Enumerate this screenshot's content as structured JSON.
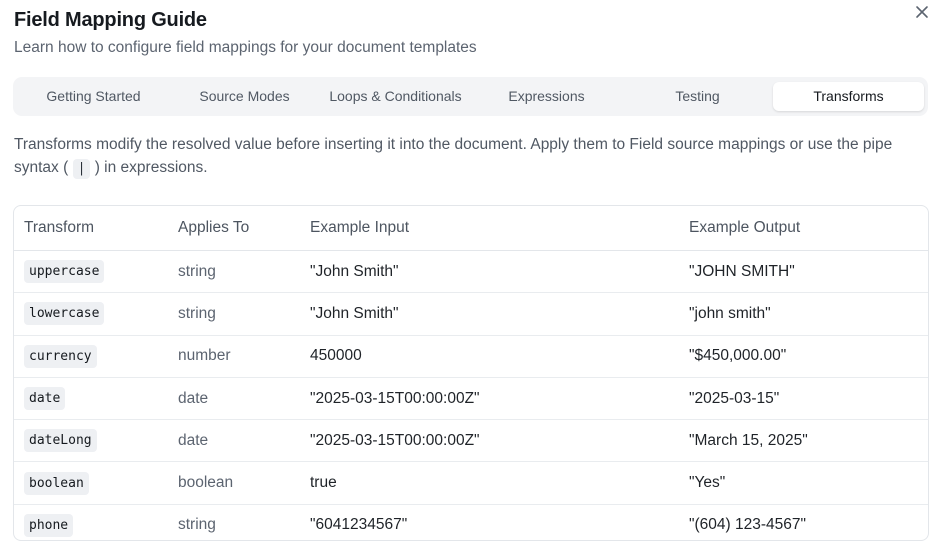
{
  "header": {
    "title": "Field Mapping Guide",
    "subtitle": "Learn how to configure field mappings for your document templates"
  },
  "tabs": [
    {
      "label": "Getting Started",
      "active": false
    },
    {
      "label": "Source Modes",
      "active": false
    },
    {
      "label": "Loops & Conditionals",
      "active": false
    },
    {
      "label": "Expressions",
      "active": false
    },
    {
      "label": "Testing",
      "active": false
    },
    {
      "label": "Transforms",
      "active": true
    }
  ],
  "description": {
    "before": "Transforms modify the resolved value before inserting it into the document. Apply them to Field source mappings or use the pipe syntax (",
    "pipe": "|",
    "after": ") in expressions."
  },
  "table": {
    "headers": [
      "Transform",
      "Applies To",
      "Example Input",
      "Example Output"
    ],
    "rows": [
      {
        "transform": "uppercase",
        "applies": "string",
        "input": "\"John Smith\"",
        "output": "\"JOHN SMITH\""
      },
      {
        "transform": "lowercase",
        "applies": "string",
        "input": "\"John Smith\"",
        "output": "\"john smith\""
      },
      {
        "transform": "currency",
        "applies": "number",
        "input": "450000",
        "output": "\"$450,000.00\""
      },
      {
        "transform": "date",
        "applies": "date",
        "input": "\"2025-03-15T00:00:00Z\"",
        "output": "\"2025-03-15\""
      },
      {
        "transform": "dateLong",
        "applies": "date",
        "input": "\"2025-03-15T00:00:00Z\"",
        "output": "\"March 15, 2025\""
      },
      {
        "transform": "boolean",
        "applies": "boolean",
        "input": "true",
        "output": "\"Yes\""
      },
      {
        "transform": "phone",
        "applies": "string",
        "input": "\"6041234567\"",
        "output": "\"(604) 123-4567\""
      }
    ]
  },
  "icons": {
    "close": "close-icon"
  }
}
